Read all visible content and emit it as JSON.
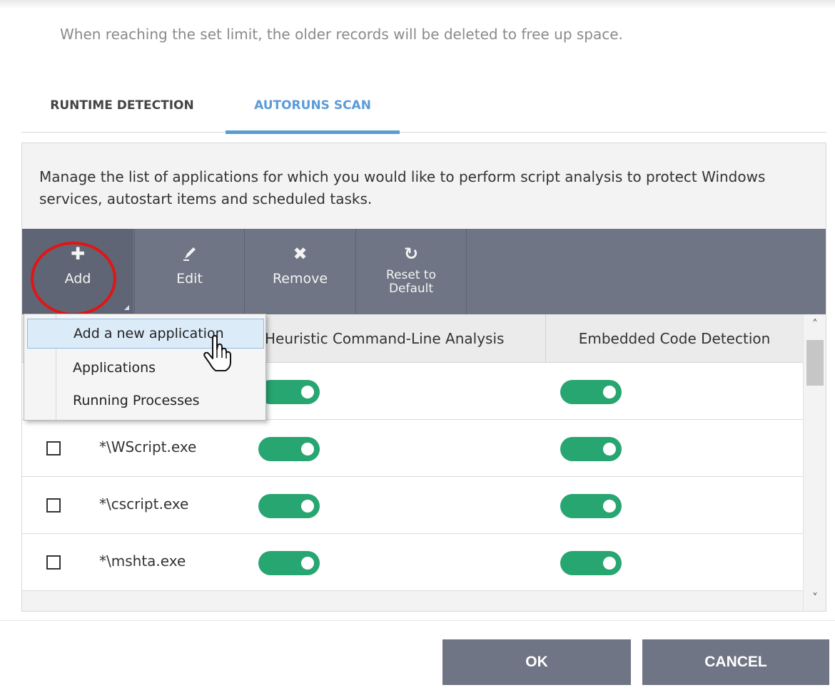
{
  "info_text": "When reaching the set limit, the older records will be deleted to free up space.",
  "tabs": [
    {
      "label": "RUNTIME DETECTION",
      "active": false
    },
    {
      "label": "AUTORUNS SCAN",
      "active": true
    }
  ],
  "description": "Manage the list of applications for which you would like to perform script analysis to protect Windows services, autostart items and scheduled tasks.",
  "toolbar": {
    "add": {
      "label": "Add",
      "icon": "plus-icon"
    },
    "edit": {
      "label": "Edit",
      "icon": "pencil-icon"
    },
    "remove": {
      "label": "Remove",
      "icon": "x-icon"
    },
    "reset_line1": "Reset to",
    "reset_line2": "Default",
    "reset_icon": "refresh-icon"
  },
  "table": {
    "columns": [
      "Heuristic Command-Line Analysis",
      "Embedded Code Detection"
    ],
    "rows": [
      {
        "name": "",
        "heuristic": true,
        "embedded": true
      },
      {
        "name": "*\\WScript.exe",
        "heuristic": true,
        "embedded": true
      },
      {
        "name": "*\\cscript.exe",
        "heuristic": true,
        "embedded": true
      },
      {
        "name": "*\\mshta.exe",
        "heuristic": true,
        "embedded": true
      }
    ]
  },
  "dropdown": {
    "items": [
      "Add a new application",
      "Applications",
      "Running Processes"
    ]
  },
  "footer": {
    "ok": "OK",
    "cancel": "CANCEL"
  },
  "colors": {
    "accent": "#5b9bd5",
    "toggle_on": "#27a672",
    "toolbar": "#6f7584",
    "highlight_circle": "#e01616"
  }
}
